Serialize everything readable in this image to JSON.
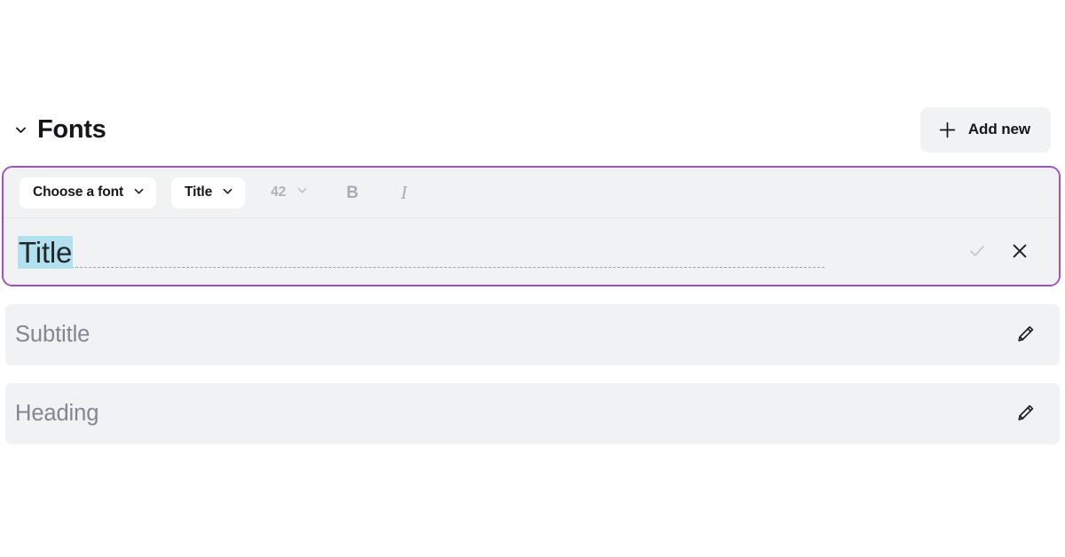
{
  "section": {
    "title": "Fonts",
    "collapse_icon": "chevron-down-icon",
    "add_new_label": "Add new",
    "add_new_icon": "plus-icon"
  },
  "editor": {
    "toolbar": {
      "font_family": {
        "label": "Choose a font",
        "chevron_icon": "chevron-down-icon"
      },
      "style_preset": {
        "label": "Title",
        "chevron_icon": "chevron-down-icon"
      },
      "font_size": {
        "value": "42",
        "chevron_icon": "chevron-down-icon",
        "disabled_color": "#aeb2b9"
      },
      "bold": {
        "label": "B",
        "icon": "bold-icon",
        "disabled_color": "#a9adb5"
      },
      "italic": {
        "label": "I",
        "icon": "italic-icon",
        "disabled_color": "#a9adb5"
      }
    },
    "field": {
      "value": "Title",
      "selection_highlight": "#b3e0ef"
    },
    "confirm_icon": "check-icon",
    "cancel_icon": "close-icon",
    "active_border_color": "#a04fc8"
  },
  "font_rows": [
    {
      "label": "Subtitle",
      "edit_icon": "pencil-icon"
    },
    {
      "label": "Heading",
      "edit_icon": "pencil-icon"
    }
  ],
  "colors": {
    "page_background": "#ffffff",
    "row_background": "#f1f2f4",
    "accent_purple": "#a04fc8",
    "muted_text": "#82868e",
    "primary_text": "#15161a"
  }
}
